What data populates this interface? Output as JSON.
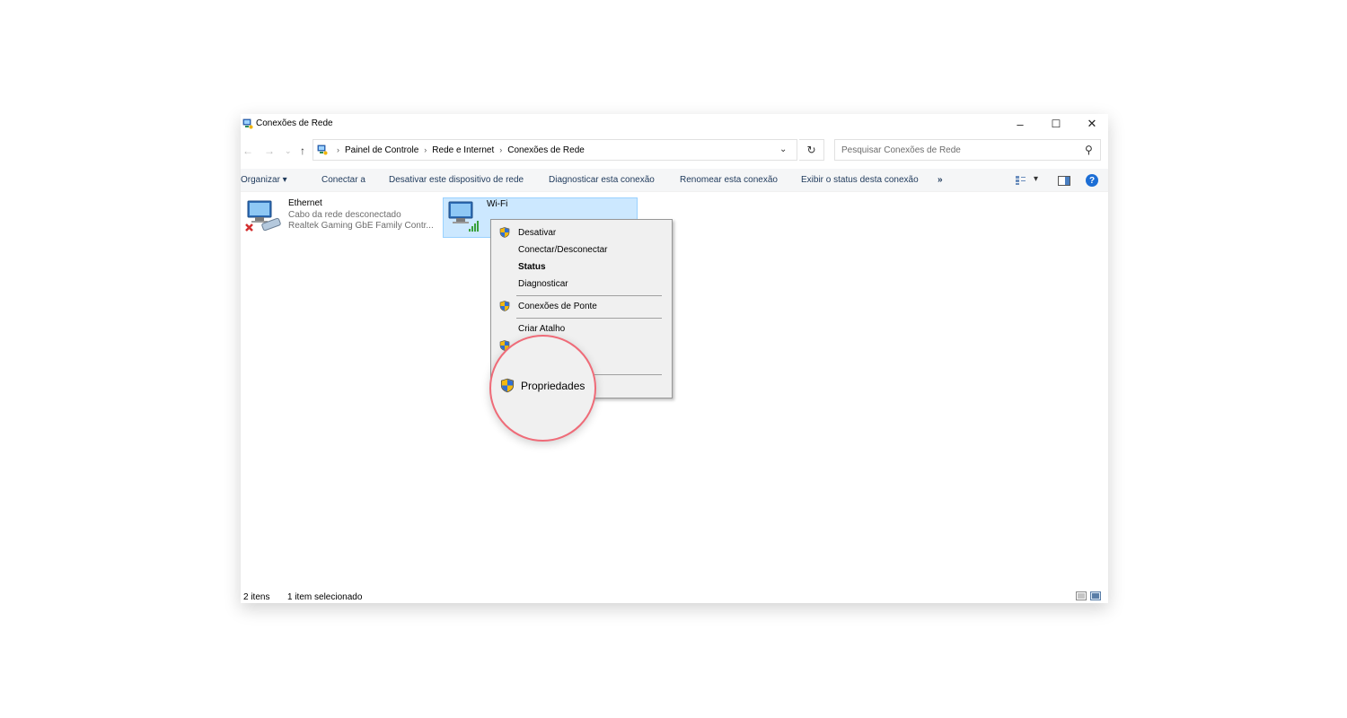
{
  "window": {
    "title": "Conexões de Rede",
    "minimize": "–",
    "maximize": "☐",
    "close": "✕"
  },
  "nav": {
    "back": "←",
    "forward": "→",
    "recent": "⌄",
    "up": "↑",
    "breadcrumb": [
      "Painel de Controle",
      "Rede e Internet",
      "Conexões de Rede"
    ],
    "separator": "›",
    "dropdown": "⌄",
    "refresh": "↻",
    "search_placeholder": "Pesquisar Conexões de Rede",
    "search_icon": "⚲"
  },
  "commandbar": {
    "organize": "Organizar ▾",
    "connect": "Conectar a",
    "disable_device": "Desativar este dispositivo de rede",
    "diagnose": "Diagnosticar esta conexão",
    "rename": "Renomear esta conexão",
    "view_status": "Exibir o status desta conexão",
    "more": "»",
    "view_options": "▾",
    "help": "?"
  },
  "connections": [
    {
      "name": "Ethernet",
      "status": "Cabo da rede desconectado",
      "device": "Realtek Gaming GbE Family Contr...",
      "icon": "network-adapter-disconnected-icon"
    },
    {
      "name": "Wi-Fi",
      "icon": "network-adapter-wifi-icon",
      "selected": true
    }
  ],
  "context_menu": {
    "items": [
      {
        "label": "Desativar",
        "shield": true
      },
      {
        "label": "Conectar/Desconectar",
        "shield": false
      },
      {
        "label": "Status",
        "shield": false,
        "bold": true
      },
      {
        "label": "Diagnosticar",
        "shield": false
      },
      {
        "label": "Conexões de Ponte",
        "shield": true
      },
      {
        "label": "Criar Atalho",
        "shield": false
      },
      {
        "label": "Propriedades",
        "shield": true
      }
    ]
  },
  "magnifier": {
    "label": "Propriedades",
    "border_color": "#ef6b78"
  },
  "statusbar": {
    "count": "2 itens",
    "selection": "1 item selecionado"
  },
  "colors": {
    "selection_bg": "#cce8ff",
    "selection_border": "#99d1ff",
    "command_text": "#1e395b",
    "help_blue": "#1c6ed5"
  }
}
